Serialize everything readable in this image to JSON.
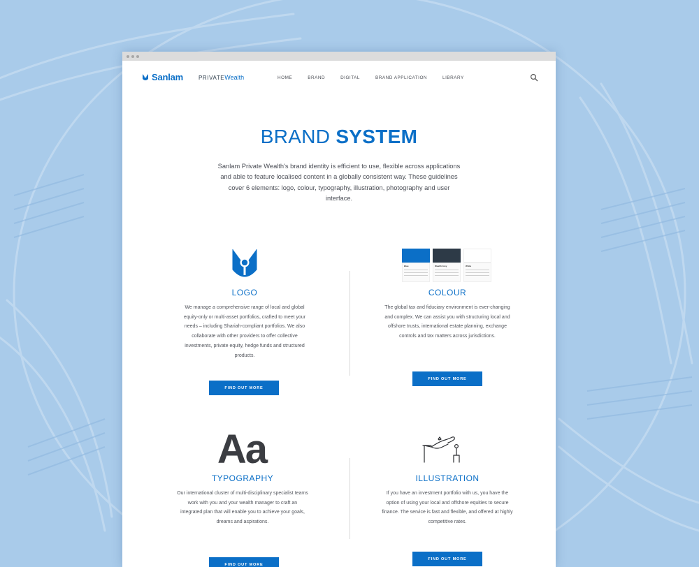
{
  "colors": {
    "brand_blue": "#0b6fc7",
    "background": "#a9cbea",
    "dark_swatch": "#2d3a47",
    "white_swatch": "#ffffff"
  },
  "nav": {
    "brand": "Sanlam",
    "sub_brand_prefix": "PRIVATE",
    "sub_brand_suffix": "Wealth",
    "items": [
      "HOME",
      "BRAND",
      "DIGITAL",
      "BRAND APPLICATION",
      "LIBRARY"
    ],
    "search_icon": "search-icon"
  },
  "hero": {
    "title_light": "BRAND",
    "title_bold": "SYSTEM",
    "intro": "Sanlam Private Wealth's brand identity is efficient to use, flexible across applications and able to feature localised content in a globally consistent way. These guidelines cover 6 elements: logo, colour, typography, illustration, photography and user interface."
  },
  "cards": [
    {
      "heading": "LOGO",
      "icon": "sanlam-shield-icon",
      "body": "We manage a comprehensive range of local and global equity-only or multi-asset portfolios, crafted to meet your needs – including Shariah-compliant portfolios. We also collaborate with other providers to offer collective investments, private equity, hedge funds and structured products.",
      "button": "FIND OUT MORE"
    },
    {
      "heading": "COLOUR",
      "icon": "colour-swatches-icon",
      "swatches": [
        "Blue",
        "Wealth Grey",
        "White"
      ],
      "body": "The global tax and fiduciary environment is ever-changing and complex. We can assist you with structuring local and offshore trusts, international estate planning, exchange controls and tax matters across jurisdictions.",
      "button": "FIND OUT MORE"
    },
    {
      "heading": "TYPOGRAPHY",
      "sample": "Aa",
      "body": "Our international cluster of multi-disciplinary specialist teams work with you and your wealth manager to craft an integrated plan that will enable you to achieve your goals, dreams and aspirations.",
      "button": "FIND OUT MORE"
    },
    {
      "heading": "ILLUSTRATION",
      "icon": "hand-illustration-icon",
      "body": "If you have an investment portfolio with us, you have the option of using your local and offshore equities to secure finance. The service is fast and flexible, and offered at highly competitive rates.",
      "button": "FIND OUT MORE"
    }
  ]
}
